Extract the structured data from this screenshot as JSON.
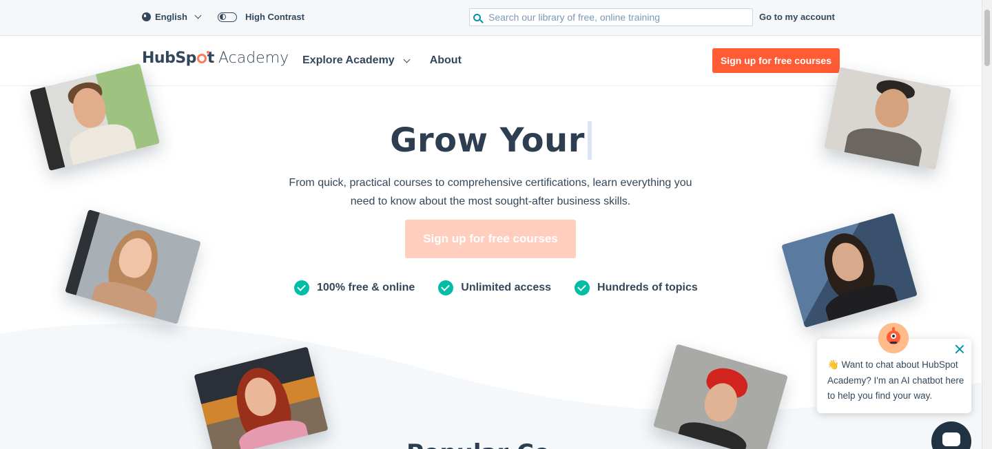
{
  "utility_bar": {
    "language": "English",
    "contrast_label": "High Contrast",
    "search_placeholder": "Search our library of free, online training",
    "account_link": "Go to my account"
  },
  "nav": {
    "logo_hub": "HubSp",
    "logo_t": "t",
    "logo_academy": "Academy",
    "items": [
      {
        "label": "Explore Academy",
        "has_dropdown": true
      },
      {
        "label": "About",
        "has_dropdown": false
      }
    ],
    "cta": "Sign up for free courses"
  },
  "hero": {
    "title": "Grow Your",
    "subtitle": "From quick, practical courses to comprehensive certifications, learn everything you need to know about the most sought-after business skills.",
    "cta": "Sign up for free courses",
    "features": [
      "100% free & online",
      "Unlimited access",
      "Hundreds of topics"
    ],
    "next_section_peek": "Popular Co"
  },
  "chat": {
    "message": "👋 Want to chat about HubSpot Academy? I'm an AI chatbot here to help you find your way."
  },
  "colors": {
    "brand_orange": "#ff5c35",
    "brand_orange_light": "#ffcebf",
    "teal_check": "#00bda5",
    "text_dark": "#33475b",
    "link_blue": "#0091ae"
  },
  "icons": [
    "globe-icon",
    "chevron-down-icon",
    "contrast-toggle-icon",
    "search-icon",
    "check-icon",
    "close-icon",
    "chat-bubble-icon"
  ]
}
